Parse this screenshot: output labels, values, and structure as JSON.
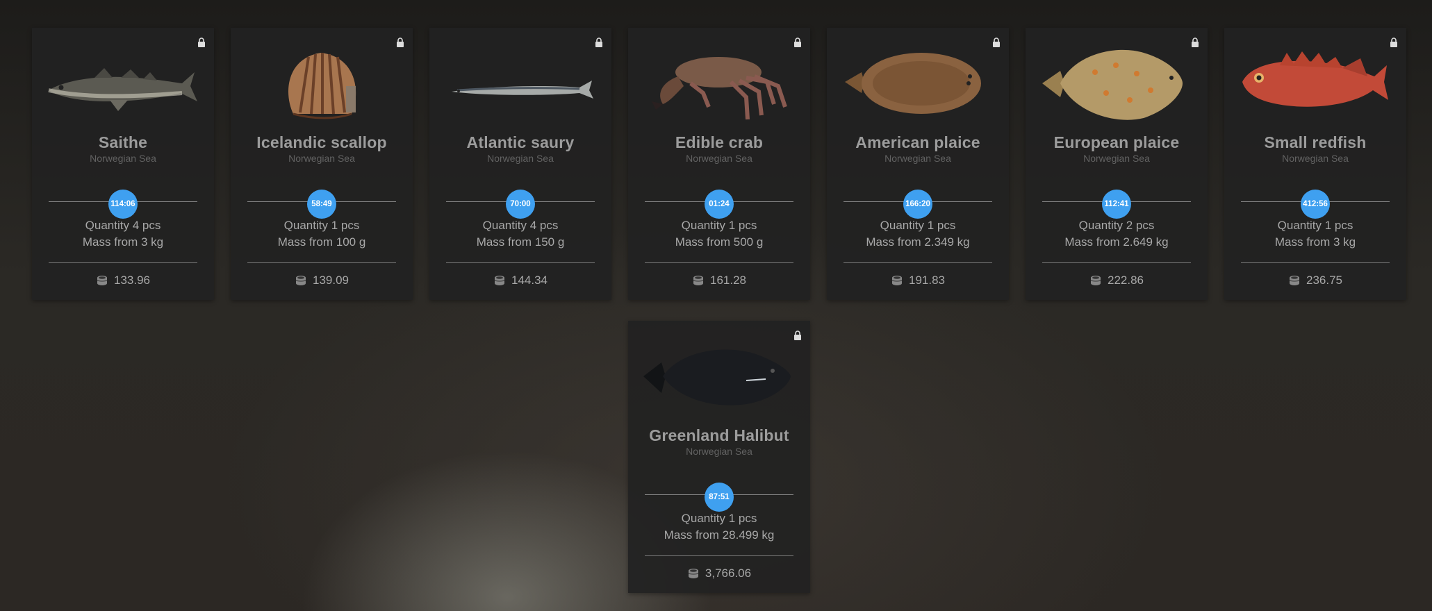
{
  "cards": [
    {
      "name": "Saithe",
      "region": "Norwegian Sea",
      "timer": "114:06",
      "quantity": "Quantity 4 pcs",
      "mass": "Mass from 3 kg",
      "price": "133.96",
      "icon": "saithe-fish-image"
    },
    {
      "name": "Icelandic scallop",
      "region": "Norwegian Sea",
      "timer": "58:49",
      "quantity": "Quantity 1 pcs",
      "mass": "Mass from 100 g",
      "price": "139.09",
      "icon": "scallop-image"
    },
    {
      "name": "Atlantic saury",
      "region": "Norwegian Sea",
      "timer": "70:00",
      "quantity": "Quantity 4 pcs",
      "mass": "Mass from 150 g",
      "price": "144.34",
      "icon": "saury-fish-image"
    },
    {
      "name": "Edible crab",
      "region": "Norwegian Sea",
      "timer": "01:24",
      "quantity": "Quantity 1 pcs",
      "mass": "Mass from 500 g",
      "price": "161.28",
      "icon": "crab-image"
    },
    {
      "name": "American plaice",
      "region": "Norwegian Sea",
      "timer": "166:20",
      "quantity": "Quantity 1 pcs",
      "mass": "Mass from 2.349 kg",
      "price": "191.83",
      "icon": "american-plaice-image"
    },
    {
      "name": "European plaice",
      "region": "Norwegian Sea",
      "timer": "112:41",
      "quantity": "Quantity 2 pcs",
      "mass": "Mass from 2.649 kg",
      "price": "222.86",
      "icon": "european-plaice-image"
    },
    {
      "name": "Small redfish",
      "region": "Norwegian Sea",
      "timer": "412:56",
      "quantity": "Quantity 1 pcs",
      "mass": "Mass from 3 kg",
      "price": "236.75",
      "icon": "redfish-image"
    },
    {
      "name": "Greenland Halibut",
      "region": "Norwegian Sea",
      "timer": "87:51",
      "quantity": "Quantity 1 pcs",
      "mass": "Mass from 28.499 kg",
      "price": "3,766.06",
      "icon": "halibut-image"
    }
  ],
  "colors": {
    "timer_badge": "#3fa0f0",
    "card_bg": "#222222",
    "name_text": "#9c9c9c",
    "region_text": "#626262"
  }
}
